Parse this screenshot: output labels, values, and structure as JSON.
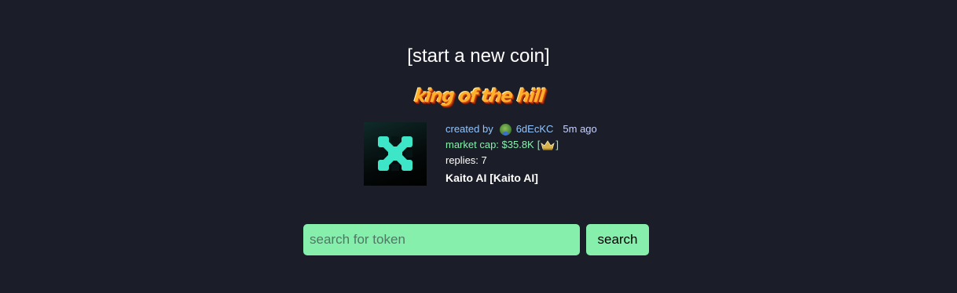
{
  "header": {
    "start_link": "[start a new coin]",
    "king_banner": "king of the hill"
  },
  "king_coin": {
    "created_by_label": "created by",
    "creator": "6dEcKC",
    "time_ago": "5m ago",
    "market_cap_label": "market cap: $35.8K",
    "badge_open": "[",
    "badge_icon": "crown-icon",
    "badge_close": "]",
    "replies": "replies: 7",
    "name": "Kaito AI [Kaito AI]",
    "logo_icon": "kaito-x-logo-icon"
  },
  "search": {
    "placeholder": "search for token",
    "value": "",
    "button_label": "search"
  },
  "colors": {
    "background": "#1b1d28",
    "accent_green": "#86efac",
    "creator_blue": "#93c5fd",
    "logo_teal": "#3ee6c8"
  }
}
